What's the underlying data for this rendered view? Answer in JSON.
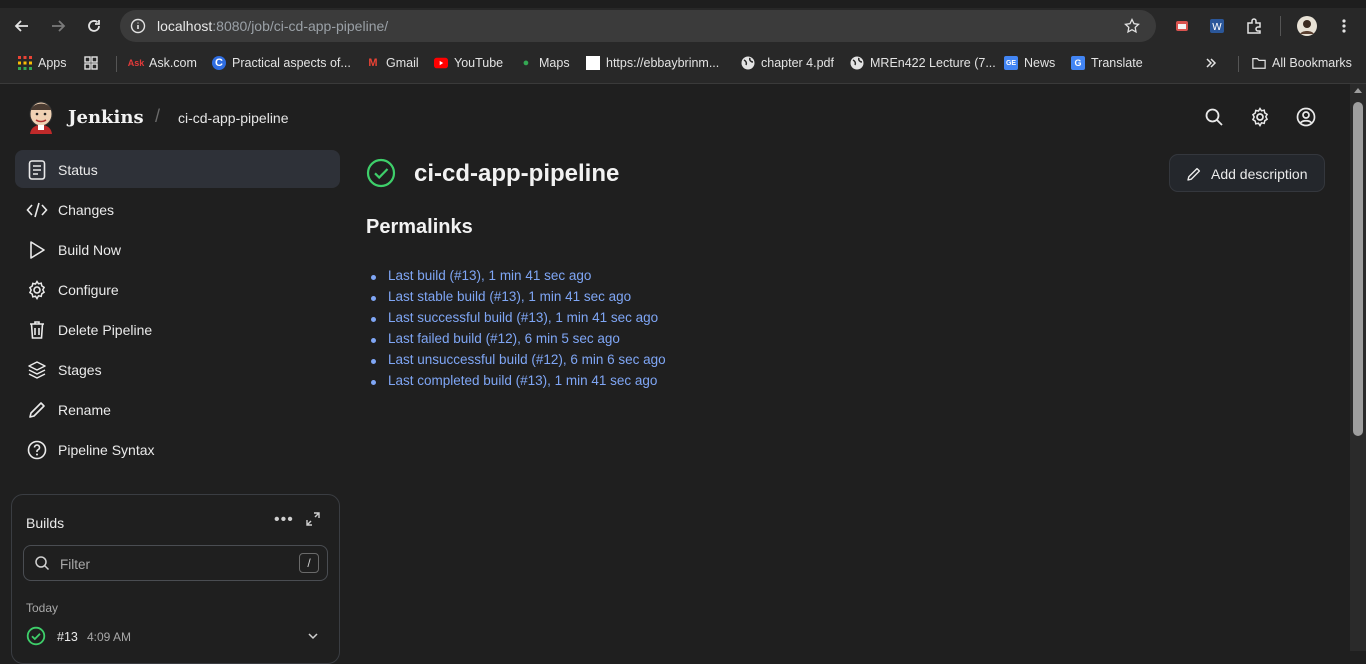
{
  "browser": {
    "url_host": "localhost",
    "url_rest": ":8080/job/ci-cd-app-pipeline/",
    "bookmarks": [
      {
        "label": "Apps",
        "icon": "apps-grid-icon"
      },
      {
        "label": "",
        "icon": "tab-groups-icon"
      },
      {
        "label": "Ask.com",
        "icon": "ask-icon"
      },
      {
        "label": "Practical aspects of...",
        "icon": "c-logo-icon"
      },
      {
        "label": "Gmail",
        "icon": "gmail-icon"
      },
      {
        "label": "YouTube",
        "icon": "youtube-icon"
      },
      {
        "label": "Maps",
        "icon": "maps-icon"
      },
      {
        "label": "https://ebbaybrinm...",
        "icon": "blank-page-icon"
      },
      {
        "label": "chapter 4.pdf",
        "icon": "globe-icon"
      },
      {
        "label": "MREn422 Lecture (7...",
        "icon": "globe-icon"
      },
      {
        "label": "News",
        "icon": "google-news-icon"
      },
      {
        "label": "Translate",
        "icon": "google-translate-icon"
      }
    ],
    "all_bookmarks": "All Bookmarks",
    "ask_icon_text": "Ask",
    "c_icon_text": "C",
    "gmail_icon_text": "M",
    "maps_icon_text": "●",
    "news_icon_text": "GE",
    "translate_icon_text": "G",
    "office_icon_text": "W"
  },
  "header": {
    "brand": "Jenkins",
    "separator": "/",
    "breadcrumb": "ci-cd-app-pipeline"
  },
  "sidebar": {
    "items": [
      {
        "label": "Status",
        "icon": "status-icon"
      },
      {
        "label": "Changes",
        "icon": "code-icon"
      },
      {
        "label": "Build Now",
        "icon": "play-icon"
      },
      {
        "label": "Configure",
        "icon": "gear-icon"
      },
      {
        "label": "Delete Pipeline",
        "icon": "trash-icon"
      },
      {
        "label": "Stages",
        "icon": "layers-icon"
      },
      {
        "label": "Rename",
        "icon": "pencil-icon"
      },
      {
        "label": "Pipeline Syntax",
        "icon": "help-circle-icon"
      }
    ]
  },
  "builds": {
    "title": "Builds",
    "more": "•••",
    "filter_placeholder": "Filter",
    "filter_shortcut": "/",
    "group": "Today",
    "rows": [
      {
        "number": "#13",
        "time": "4:09 AM",
        "status": "success"
      }
    ]
  },
  "main": {
    "job_title": "ci-cd-app-pipeline",
    "add_description": "Add description",
    "permalinks_heading": "Permalinks",
    "permalinks": [
      "Last build (#13), 1 min 41 sec ago",
      "Last stable build (#13), 1 min 41 sec ago",
      "Last successful build (#13), 1 min 41 sec ago",
      "Last failed build (#12), 6 min 5 sec ago",
      "Last unsuccessful build (#12), 6 min 6 sec ago",
      "Last completed build (#13), 1 min 41 sec ago"
    ]
  },
  "colors": {
    "success": "#3ecf6a",
    "link": "#7fa6f5",
    "background": "#1f1f1f"
  }
}
